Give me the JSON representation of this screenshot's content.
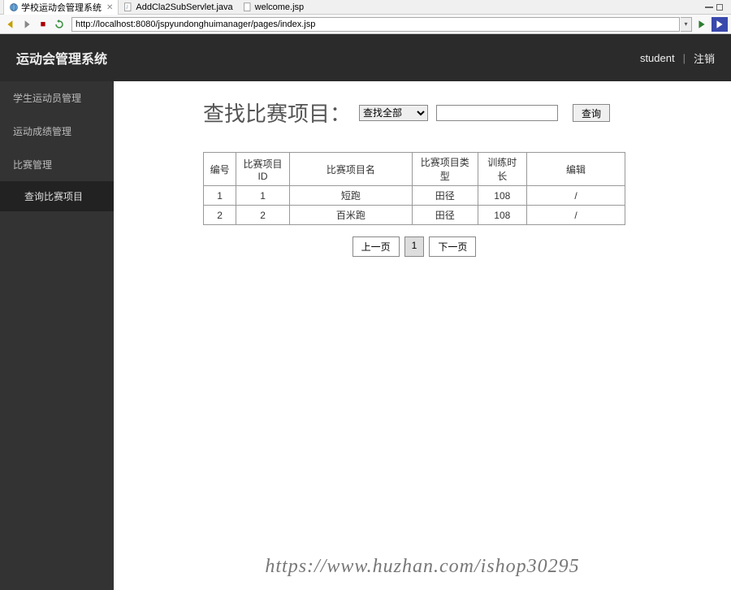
{
  "ide": {
    "tabs": [
      {
        "label": "学校运动会管理系统",
        "active": true,
        "icon": "globe"
      },
      {
        "label": "AddCla2SubServlet.java",
        "active": false,
        "icon": "java"
      },
      {
        "label": "welcome.jsp",
        "active": false,
        "icon": "jsp"
      }
    ]
  },
  "browser": {
    "url": "http://localhost:8080/jspyundonghuimanager/pages/index.jsp"
  },
  "app": {
    "title": "运动会管理系统",
    "user": "student",
    "logout": "注销"
  },
  "sidebar": {
    "items": [
      "学生运动员管理",
      "运动成绩管理",
      "比赛管理"
    ],
    "sub": "查询比赛项目"
  },
  "search": {
    "title": "查找比赛项目：",
    "select_value": "查找全部",
    "button": "查询"
  },
  "table": {
    "headers": [
      "编号",
      "比赛项目ID",
      "比赛项目名",
      "比赛项目类型",
      "训练时长",
      "编辑"
    ],
    "rows": [
      {
        "no": "1",
        "pid": "1",
        "name": "短跑",
        "type": "田径",
        "dur": "108",
        "edit": "/"
      },
      {
        "no": "2",
        "pid": "2",
        "name": "百米跑",
        "type": "田径",
        "dur": "108",
        "edit": "/"
      }
    ]
  },
  "pager": {
    "prev": "上一页",
    "current": "1",
    "next": "下一页"
  },
  "watermark": "https://www.huzhan.com/ishop30295"
}
